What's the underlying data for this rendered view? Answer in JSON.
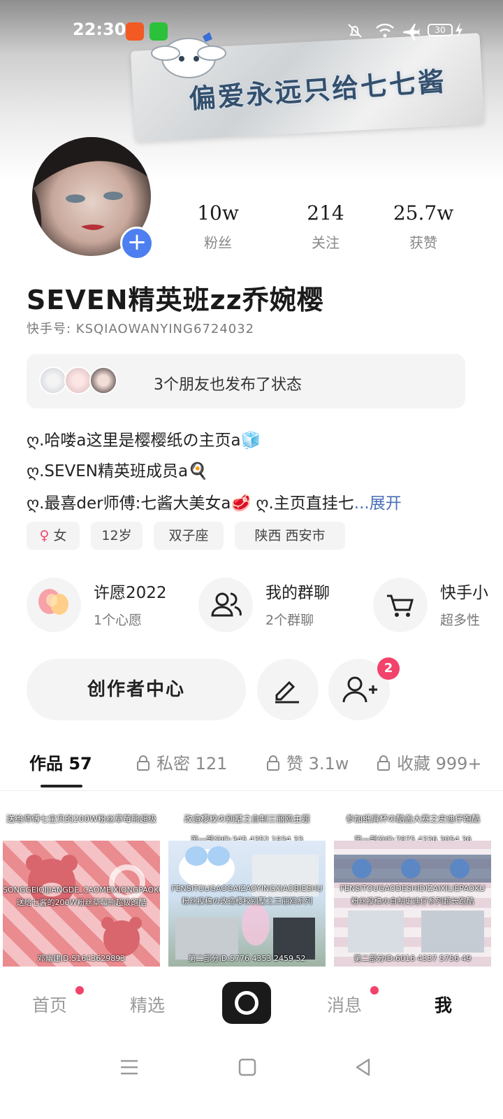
{
  "status_bar": {
    "time": "22:30",
    "battery": "30",
    "icons": [
      "mute-icon",
      "wifi-icon",
      "airplane-icon",
      "battery-icon",
      "charging-icon"
    ]
  },
  "banner": {
    "text": "偏爱永远只给七七酱"
  },
  "profile": {
    "stats": [
      {
        "value": "10w",
        "label": "粉丝"
      },
      {
        "value": "214",
        "label": "关注"
      },
      {
        "value": "25.7w",
        "label": "获赞"
      }
    ],
    "username": "SEVEN精英班zz乔婉樱",
    "kuaishou_id": "快手号: KSQIAOWANYING6724032"
  },
  "friends_status": {
    "text": "3个朋友也发布了状态"
  },
  "bio": {
    "line1": "ღ.哈喽a这里是樱樱纸の主页a🧊",
    "line2": "ღ.SEVEN精英班成员a🍳",
    "line3": "ღ.最喜der师傅:七酱大美女a🥩 ღ.主页直挂七",
    "expand": "...展开"
  },
  "tags": [
    {
      "icon": "♀",
      "label": "女"
    },
    {
      "label": "12岁"
    },
    {
      "label": "双子座"
    },
    {
      "label": "陕西 西安市"
    }
  ],
  "features": [
    {
      "title": "许愿2022",
      "subtitle": "1个心愿",
      "icon": "lantern-icon"
    },
    {
      "title": "我的群聊",
      "subtitle": "2个群聊",
      "icon": "group-icon"
    },
    {
      "title": "快手小",
      "subtitle": "超多性",
      "icon": "cart-icon"
    }
  ],
  "actions": {
    "creator_center": "创作者中心",
    "notification_count": "2"
  },
  "tabs": [
    {
      "label": "作品 57"
    },
    {
      "label": "私密 121"
    },
    {
      "label": "赞 3.1w"
    },
    {
      "label": "收藏 999+"
    }
  ],
  "videos": [
    {
      "caption": "送给师傅七宝贝的200W粉丝草莓熊超级",
      "sub1": "SONGGEIQIJIANGDE_CAOMEIXIONGPAOKU",
      "sub2": "送给七酱的200W粉丝草莓熊超级跑酷",
      "sub3": "邓幽建ID:51643629893"
    },
    {
      "caption": "改造樱校の别墅之自制三丽鸥主题",
      "sub0": "第一部分ID:345 4352 1934 33",
      "sub1": "FENSITOUGAOGAIZAOYINGXIAOBIESHU",
      "sub2": "粉丝投稿の改造樱校别墅之三丽鸥系列",
      "sub3": "第二部分ID:5776 4353 2459 52"
    },
    {
      "caption": "参加纸屑杯の酷盖大赛之史迪仔跑酷",
      "sub0": "第一部分ID:7875 4336 3054 36",
      "sub1": "FENSITOUGAODESHIDIZAIXILIEPAOKU",
      "sub2": "粉丝投稿の自制史迪仔系列超长跑酷",
      "sub3": "第二部分ID:6016 4337 5756 49"
    }
  ],
  "bottom_nav": [
    {
      "label": "首页",
      "dot": true
    },
    {
      "label": "精选",
      "dot": false
    },
    {
      "label": "消息",
      "dot": true
    },
    {
      "label": "我",
      "dot": false
    }
  ],
  "colors": {
    "accent_blue": "#4d7ff0",
    "badge_pink": "#f2436b",
    "link_blue": "#4a6fb8"
  }
}
